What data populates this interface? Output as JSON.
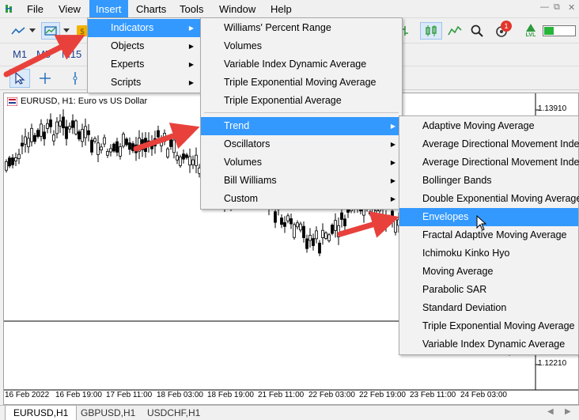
{
  "menubar": {
    "items": [
      "File",
      "View",
      "Insert",
      "Charts",
      "Tools",
      "Window",
      "Help"
    ],
    "active": "Insert"
  },
  "toolbar": {
    "timeframes": [
      "M1",
      "M5",
      "M15"
    ],
    "notification_count": "1",
    "lvl_label": "LVL"
  },
  "chart": {
    "symbol_title": "EURUSD, H1:  Euro vs US Dollar",
    "price_labels": [
      "1.13910",
      "1.12210"
    ],
    "date_labels": [
      "16 Feb 2022",
      "16 Feb 19:00",
      "17 Feb 11:00",
      "18 Feb 03:00",
      "18 Feb 19:00",
      "21 Feb 11:00",
      "22 Feb 03:00",
      "22 Feb 19:00",
      "23 Feb 11:00",
      "24 Feb 03:00"
    ]
  },
  "bottom_tabs": {
    "items": [
      "EURUSD,H1",
      "GBPUSD,H1",
      "USDCHF,H1"
    ],
    "active": "EURUSD,H1"
  },
  "insert_menu": {
    "items": [
      "Indicators",
      "Objects",
      "Experts",
      "Scripts"
    ],
    "active": "Indicators"
  },
  "indicators_menu": {
    "top_items": [
      "Williams' Percent Range",
      "Volumes",
      "Variable Index Dynamic Average",
      "Triple Exponential Moving Average",
      "Triple Exponential Average"
    ],
    "group_items": [
      "Trend",
      "Oscillators",
      "Volumes",
      "Bill Williams",
      "Custom"
    ],
    "active": "Trend"
  },
  "trend_menu": {
    "items": [
      "Adaptive Moving Average",
      "Average Directional Movement Index",
      "Average Directional Movement Index",
      "Bollinger Bands",
      "Double Exponential Moving Average",
      "Envelopes",
      "Fractal Adaptive Moving Average",
      "Ichimoku Kinko Hyo",
      "Moving Average",
      "Parabolic SAR",
      "Standard Deviation",
      "Triple Exponential Moving Average",
      "Variable Index Dynamic Average"
    ],
    "active": "Envelopes"
  },
  "colors": {
    "highlight": "#3399ff",
    "annotation_arrow": "#e8413c"
  }
}
